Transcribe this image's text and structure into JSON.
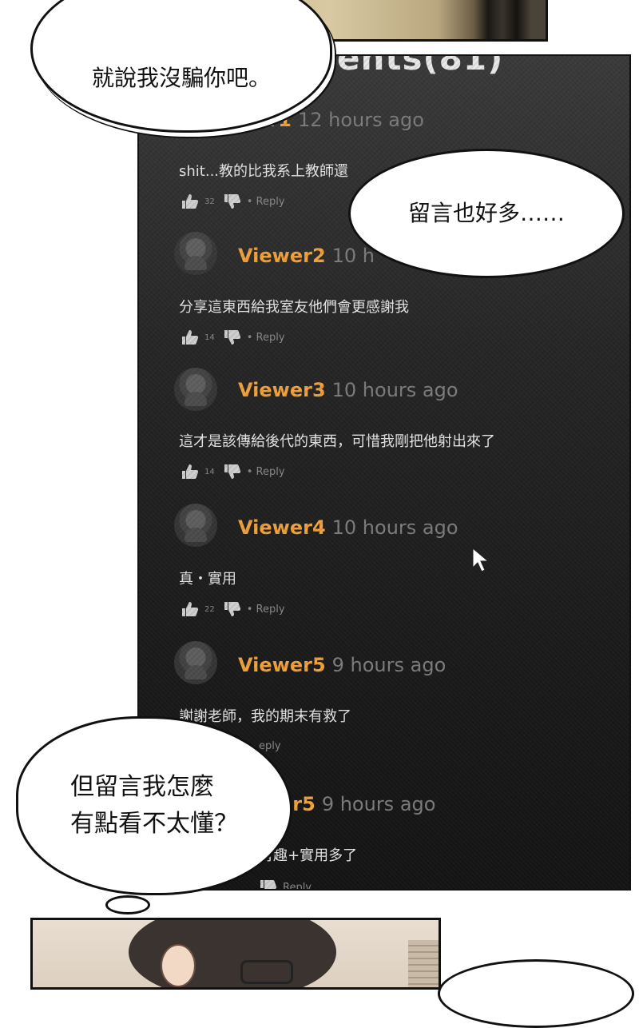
{
  "comments_title": "ents(81)",
  "comments": [
    {
      "user": "wer1",
      "time": "12 hours ago",
      "text": "shit...教的比我系上教師還",
      "likes": "32",
      "reply": "• Reply"
    },
    {
      "user": "Viewer2",
      "time": "10 h",
      "text": "分享這東西給我室友他們會更感謝我",
      "likes": "14",
      "reply": "• Reply"
    },
    {
      "user": "Viewer3",
      "time": "10 hours ago",
      "text": "這才是該傳給後代的東西，可惜我剛把他射出來了",
      "likes": "14",
      "reply": "• Reply"
    },
    {
      "user": "Viewer4",
      "time": "10 hours ago",
      "text": "真・實用",
      "likes": "22",
      "reply": "• Reply"
    },
    {
      "user": "Viewer5",
      "time": "9 hours ago",
      "text": "謝謝老師，我的期末有救了",
      "likes": "",
      "reply": "eply"
    },
    {
      "user": "er5",
      "time": "9 hours ago",
      "text": "有趣+實用多了",
      "likes": "",
      "reply": "Reply"
    }
  ],
  "bubbles": {
    "b1": "就說我沒騙你吧。",
    "b2": "留言也好多……",
    "b3": "但留言我怎麼\n有點看不太懂？"
  },
  "icons": [
    "thumbs-up-icon",
    "thumbs-down-icon",
    "cursor-icon",
    "avatar-icon"
  ],
  "colors": {
    "username": "#f2a23a",
    "timestamp": "#7d7d7d",
    "panel": "#1e1e1e"
  }
}
